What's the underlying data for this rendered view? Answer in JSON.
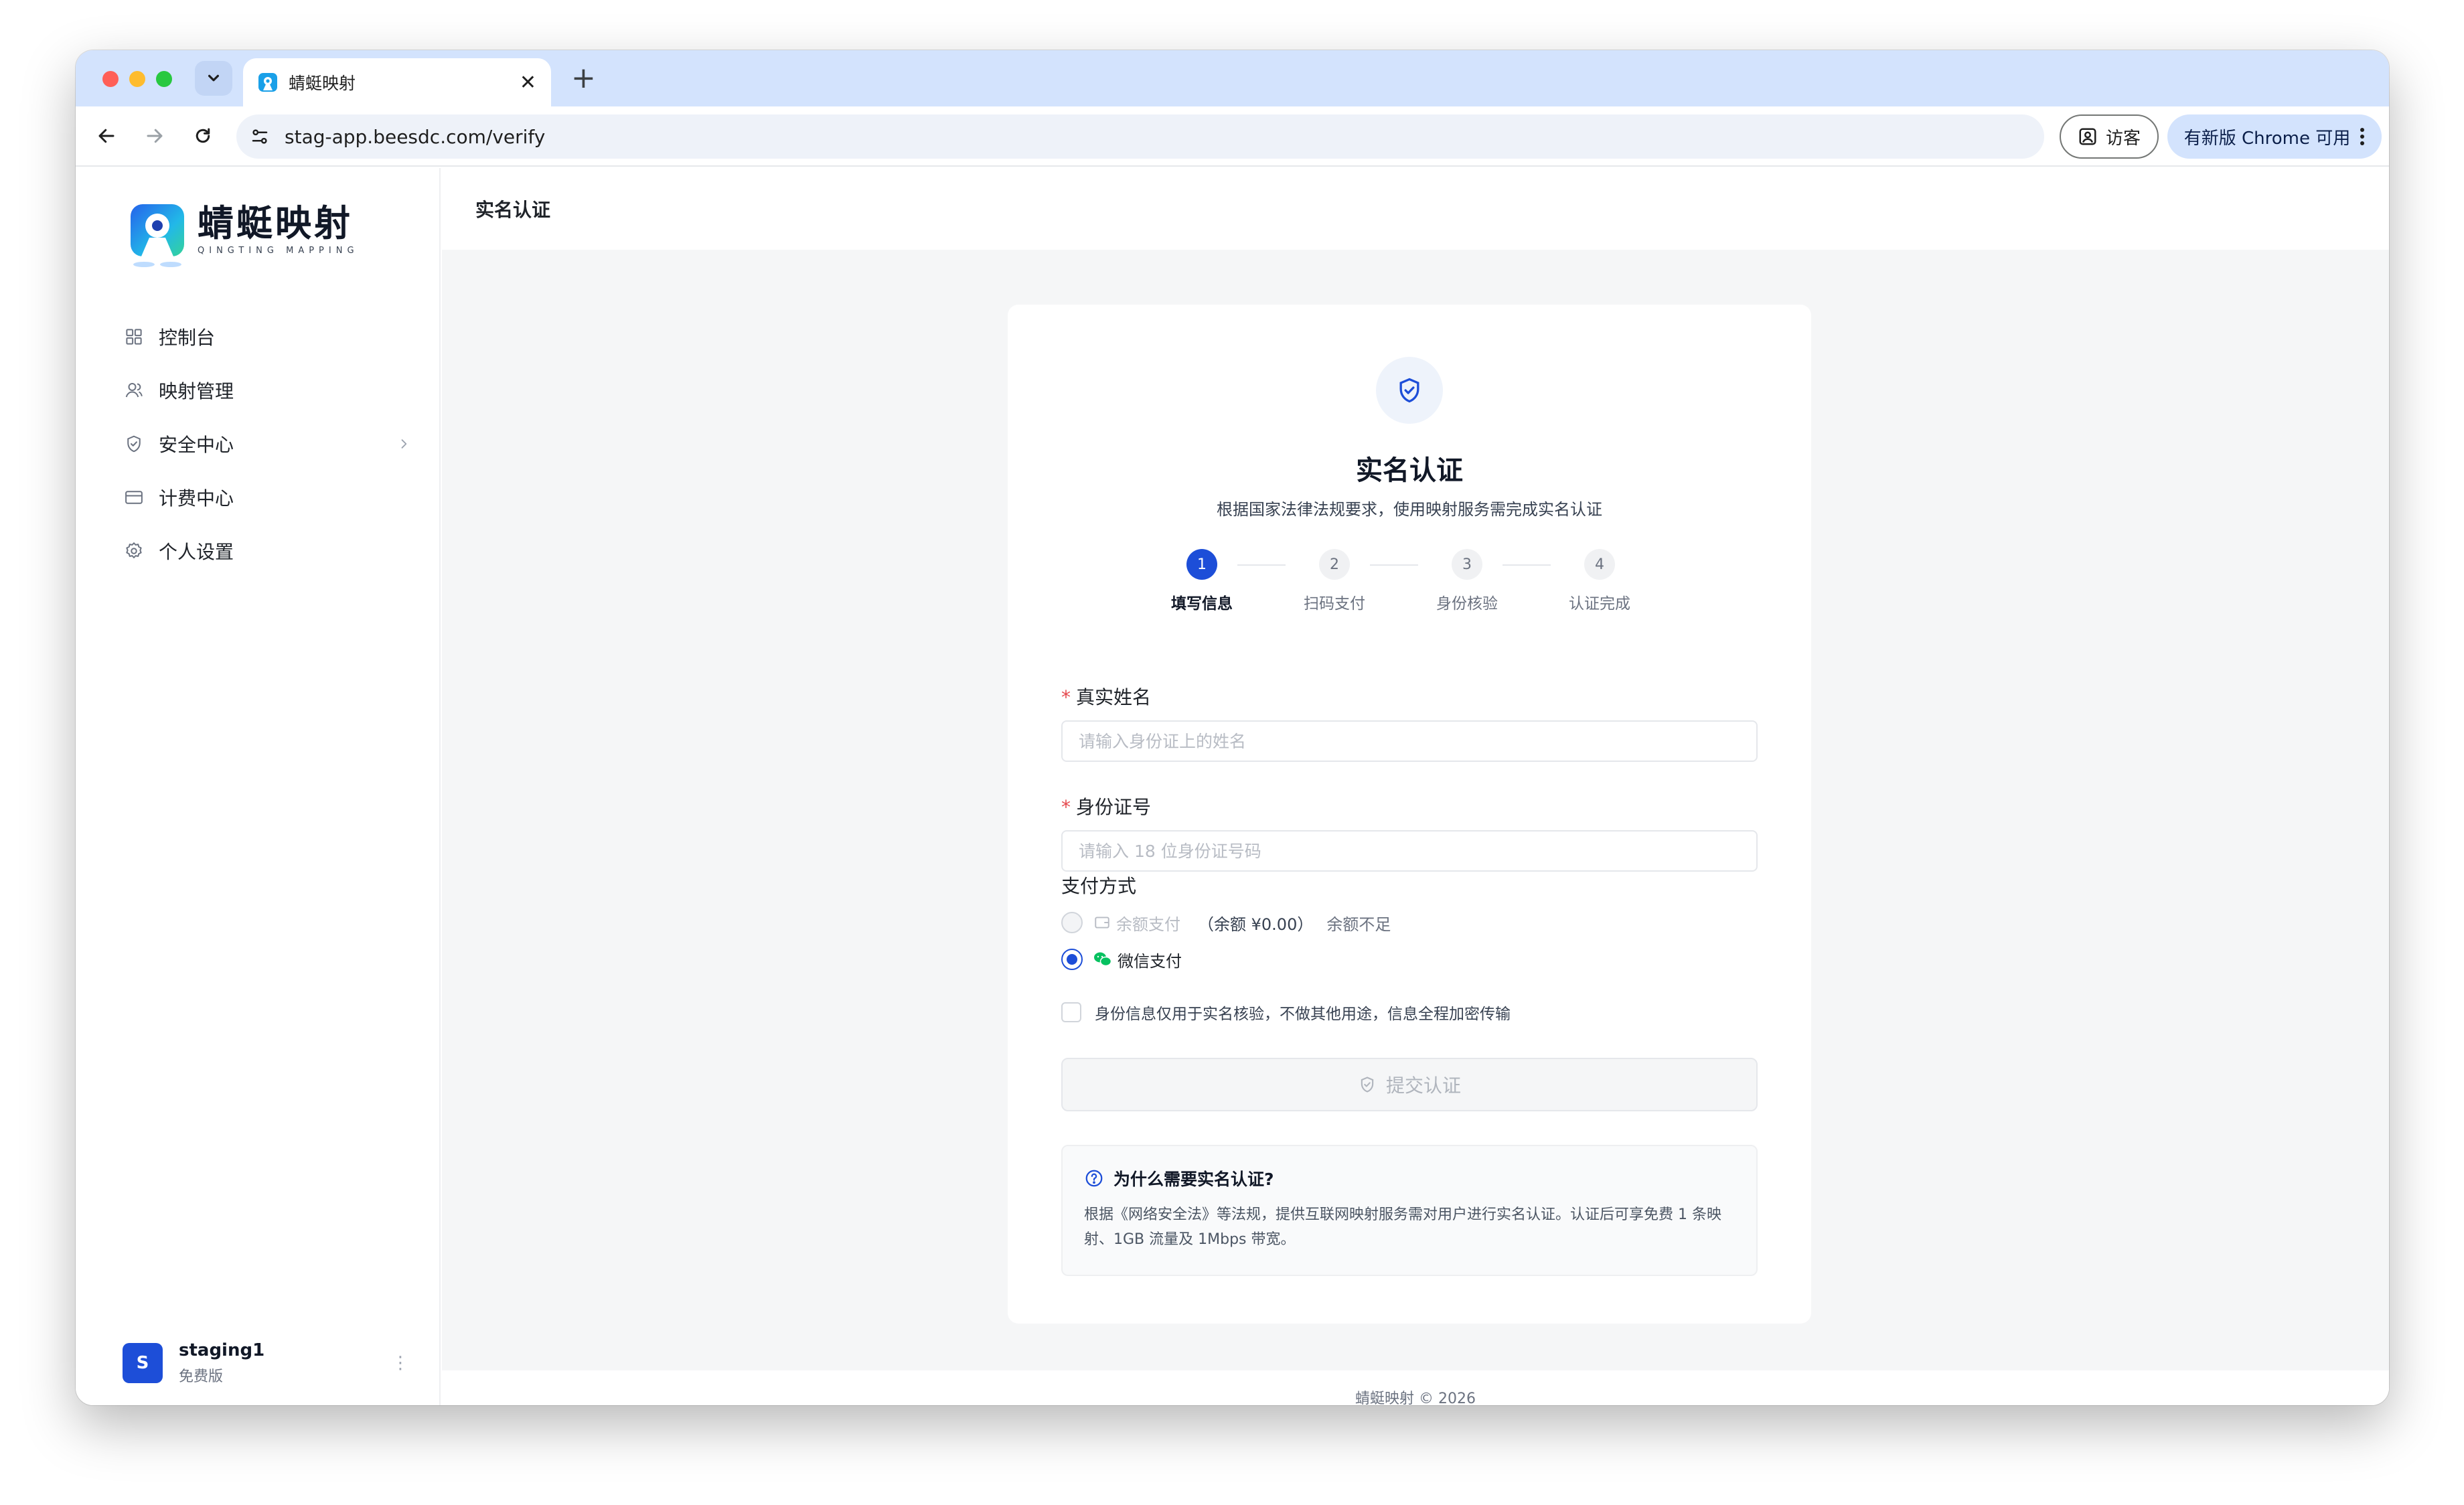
{
  "browser": {
    "tab_title": "蜻蜓映射",
    "url": "stag-app.beesdc.com/verify",
    "guest_label": "访客",
    "update_label": "有新版 Chrome 可用"
  },
  "brand": {
    "name_cn": "蜻蜓映射",
    "name_en": "QINGTING MAPPING",
    "accent_color": "#1d4ed8"
  },
  "sidebar": {
    "items": [
      {
        "label": "控制台",
        "icon": "dashboard-icon"
      },
      {
        "label": "映射管理",
        "icon": "users-icon"
      },
      {
        "label": "安全中心",
        "icon": "shield-icon",
        "has_submenu": true
      },
      {
        "label": "计费中心",
        "icon": "credit-card-icon"
      },
      {
        "label": "个人设置",
        "icon": "gear-icon"
      }
    ]
  },
  "user": {
    "avatar_letter": "S",
    "name": "staging1",
    "plan": "免费版"
  },
  "page": {
    "title": "实名认证"
  },
  "verify": {
    "title": "实名认证",
    "subtitle": "根据国家法律法规要求，使用映射服务需完成实名认证",
    "steps": [
      {
        "number": "1",
        "label": "填写信息",
        "active": true
      },
      {
        "number": "2",
        "label": "扫码支付",
        "active": false
      },
      {
        "number": "3",
        "label": "身份核验",
        "active": false
      },
      {
        "number": "4",
        "label": "认证完成",
        "active": false
      }
    ],
    "required_mark": "*",
    "name_label": "真实姓名",
    "name_placeholder": "请输入身份证上的姓名",
    "id_label": "身份证号",
    "id_placeholder": "请输入 18 位身份证号码",
    "payment_label": "支付方式",
    "payment_options": [
      {
        "label": "余额支付",
        "balance": "（余额 ¥0.00）",
        "note": "余额不足",
        "selected": false,
        "disabled": true
      },
      {
        "label": "微信支付",
        "selected": true,
        "disabled": false
      }
    ],
    "agreement": "身份信息仅用于实名核验，不做其他用途，信息全程加密传输",
    "submit_label": "提交认证",
    "faq_title": "为什么需要实名认证?",
    "faq_body": "根据《网络安全法》等法规，提供互联网映射服务需对用户进行实名认证。认证后可享免费 1 条映射、1GB 流量及 1Mbps 带宽。"
  },
  "footer": {
    "text": "蜻蜓映射 © 2026"
  }
}
